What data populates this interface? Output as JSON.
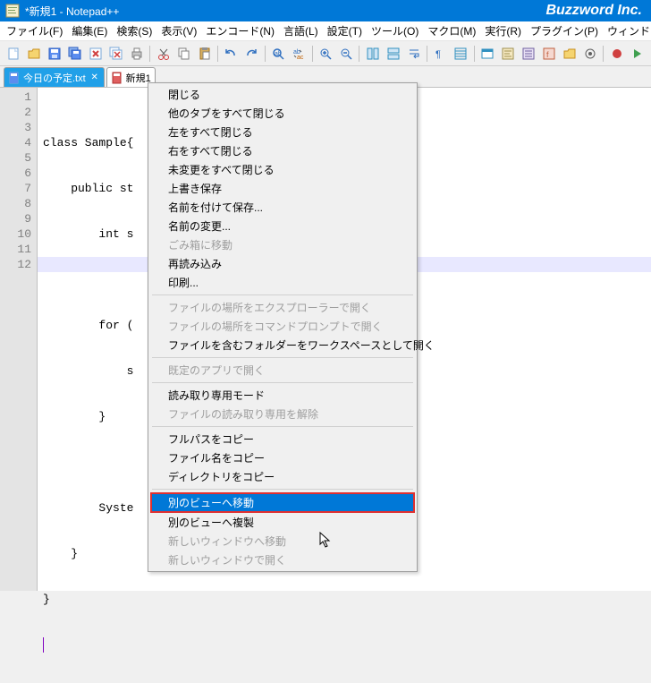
{
  "titlebar": {
    "title": "*新規1 - Notepad++",
    "brand": "Buzzword Inc."
  },
  "menubar": {
    "items": [
      "ファイル(F)",
      "編集(E)",
      "検索(S)",
      "表示(V)",
      "エンコード(N)",
      "言語(L)",
      "設定(T)",
      "ツール(O)",
      "マクロ(M)",
      "実行(R)",
      "プラグイン(P)",
      "ウィンドウ管理(W)"
    ]
  },
  "tabs": [
    {
      "label": "今日の予定.txt",
      "active": false
    },
    {
      "label": "新規1",
      "active": true
    }
  ],
  "gutter": [
    "1",
    "2",
    "3",
    "4",
    "5",
    "6",
    "7",
    "8",
    "9",
    "10",
    "11",
    "12"
  ],
  "code": {
    "lines": [
      "class Sample{",
      "    public st",
      "        int s",
      "",
      "        for (",
      "            s",
      "        }",
      "",
      "        Syste",
      "    }",
      "}",
      ""
    ]
  },
  "context_menu": {
    "items": [
      {
        "label": "閉じる",
        "type": "item"
      },
      {
        "label": "他のタブをすべて閉じる",
        "type": "item"
      },
      {
        "label": "左をすべて閉じる",
        "type": "item"
      },
      {
        "label": "右をすべて閉じる",
        "type": "item"
      },
      {
        "label": "未変更をすべて閉じる",
        "type": "item"
      },
      {
        "label": "上書き保存",
        "type": "item"
      },
      {
        "label": "名前を付けて保存...",
        "type": "item"
      },
      {
        "label": "名前の変更...",
        "type": "item"
      },
      {
        "label": "ごみ箱に移動",
        "type": "disabled"
      },
      {
        "label": "再読み込み",
        "type": "item"
      },
      {
        "label": "印刷...",
        "type": "item"
      },
      {
        "type": "sep"
      },
      {
        "label": "ファイルの場所をエクスプローラーで開く",
        "type": "disabled"
      },
      {
        "label": "ファイルの場所をコマンドプロンプトで開く",
        "type": "disabled"
      },
      {
        "label": "ファイルを含むフォルダーをワークスペースとして開く",
        "type": "item"
      },
      {
        "type": "sep"
      },
      {
        "label": "既定のアプリで開く",
        "type": "disabled"
      },
      {
        "type": "sep"
      },
      {
        "label": "読み取り専用モード",
        "type": "item"
      },
      {
        "label": "ファイルの読み取り専用を解除",
        "type": "disabled"
      },
      {
        "type": "sep"
      },
      {
        "label": "フルパスをコピー",
        "type": "item"
      },
      {
        "label": "ファイル名をコピー",
        "type": "item"
      },
      {
        "label": "ディレクトリをコピー",
        "type": "item"
      },
      {
        "type": "sep"
      },
      {
        "label": "別のビューへ移動",
        "type": "highlighted"
      },
      {
        "label": "別のビューへ複製",
        "type": "item"
      },
      {
        "label": "新しいウィンドウへ移動",
        "type": "disabled"
      },
      {
        "label": "新しいウィンドウで開く",
        "type": "disabled"
      }
    ]
  }
}
